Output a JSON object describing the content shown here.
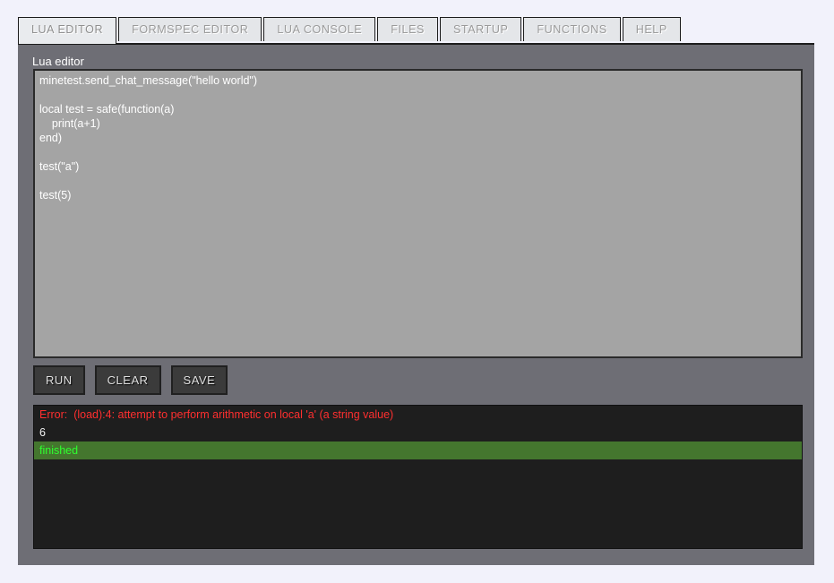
{
  "window": {
    "background_color": "#f2f2fb",
    "panel_color": "#6e6e75"
  },
  "tabs": {
    "active_index": 0,
    "items": [
      {
        "label": "LUA EDITOR"
      },
      {
        "label": "FORMSPEC EDITOR"
      },
      {
        "label": "LUA CONSOLE"
      },
      {
        "label": "FILES"
      },
      {
        "label": "STARTUP"
      },
      {
        "label": "FUNCTIONS"
      },
      {
        "label": "HELP"
      }
    ]
  },
  "editor": {
    "label": "Lua editor",
    "code": "minetest.send_chat_message(\"hello world\")\n\nlocal test = safe(function(a)\n    print(a+1)\nend)\n\ntest(\"a\")\n\ntest(5)"
  },
  "buttons": [
    {
      "label": "RUN"
    },
    {
      "label": "CLEAR"
    },
    {
      "label": "SAVE"
    }
  ],
  "console": {
    "background_color": "#1e1e1e",
    "error_color": "#ff2f2f",
    "success_bg_color": "#44762e",
    "success_text_color": "#2fff2f",
    "lines": [
      {
        "text": "Error:  (load):4: attempt to perform arithmetic on local 'a' (a string value)",
        "kind": "error"
      },
      {
        "text": "6",
        "kind": "normal"
      },
      {
        "text": "finished",
        "kind": "ok"
      }
    ]
  }
}
